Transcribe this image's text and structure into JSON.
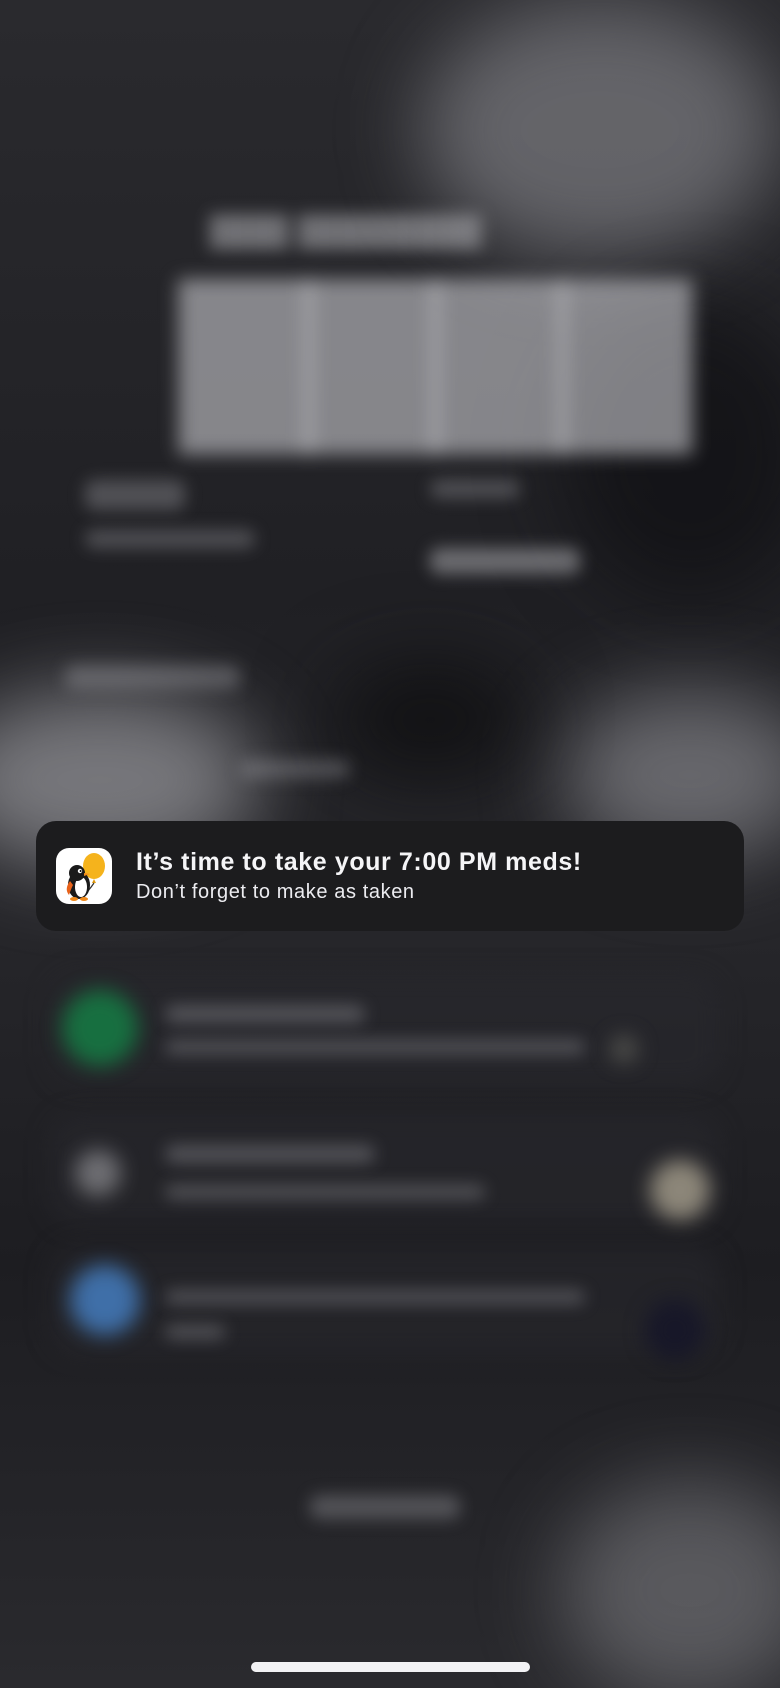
{
  "notification": {
    "app_icon": "penguin-balloon-app-icon",
    "title": "It’s time to take your 7:00 PM meds!",
    "body": "Don’t forget to make as taken"
  },
  "colors": {
    "notification_background": "#1c1c1e",
    "notification_text": "#f5f5f7",
    "home_indicator": "#f2f2f4",
    "app_icon_accent": "#f5b31c"
  }
}
